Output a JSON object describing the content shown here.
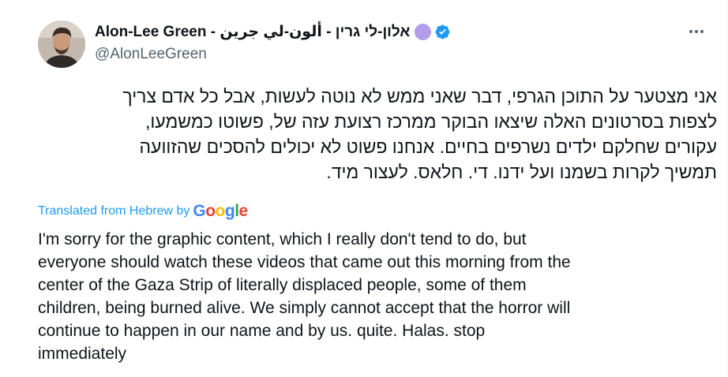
{
  "tweet": {
    "author": {
      "display_name": "Alon-Lee Green - אלון-לי גרין - ألون-لي جرين",
      "handle": "@AlonLeeGreen",
      "avatar": "avatar"
    },
    "more_icon": "more-icon",
    "verified_icon": "verified-badge-icon",
    "hebrew_lines": [
      "אני מצטער על התוכן הגרפי, דבר שאני ממש לא נוטה לעשות, אבל כל אדם צריך",
      "לצפות בסרטונים האלה שיצאו הבוקר ממרכז רצועת עזה של, פשוטו כמשמעו,",
      "עקורים שחלקם ילדים נשרפים בחיים. אנחנו פשוט לא יכולים להסכים שהזוועה",
      "תמשיך לקרות בשמנו ועל ידנו. די. חלאס. לעצור מיד."
    ],
    "translation": {
      "label": "Translated from Hebrew by",
      "provider_letters": [
        "G",
        "o",
        "o",
        "g",
        "l",
        "e"
      ],
      "provider_colors": [
        "#4285f4",
        "#ea4335",
        "#fbbc05",
        "#4285f4",
        "#34a853",
        "#ea4335"
      ]
    },
    "english_lines": [
      "I'm sorry for the graphic content, which I really don't tend to do, but",
      "everyone should watch these videos that came out this morning from the",
      "center of the Gaza Strip of literally displaced people, some of them",
      "children, being burned alive. We simply cannot accept that the horror will",
      "continue to happen in our name and by us. quite. Halas. stop",
      "immediately"
    ],
    "colors": {
      "link": "#1d9bf0",
      "verified": "#1d9bf0",
      "secondary_text": "#536471"
    }
  }
}
